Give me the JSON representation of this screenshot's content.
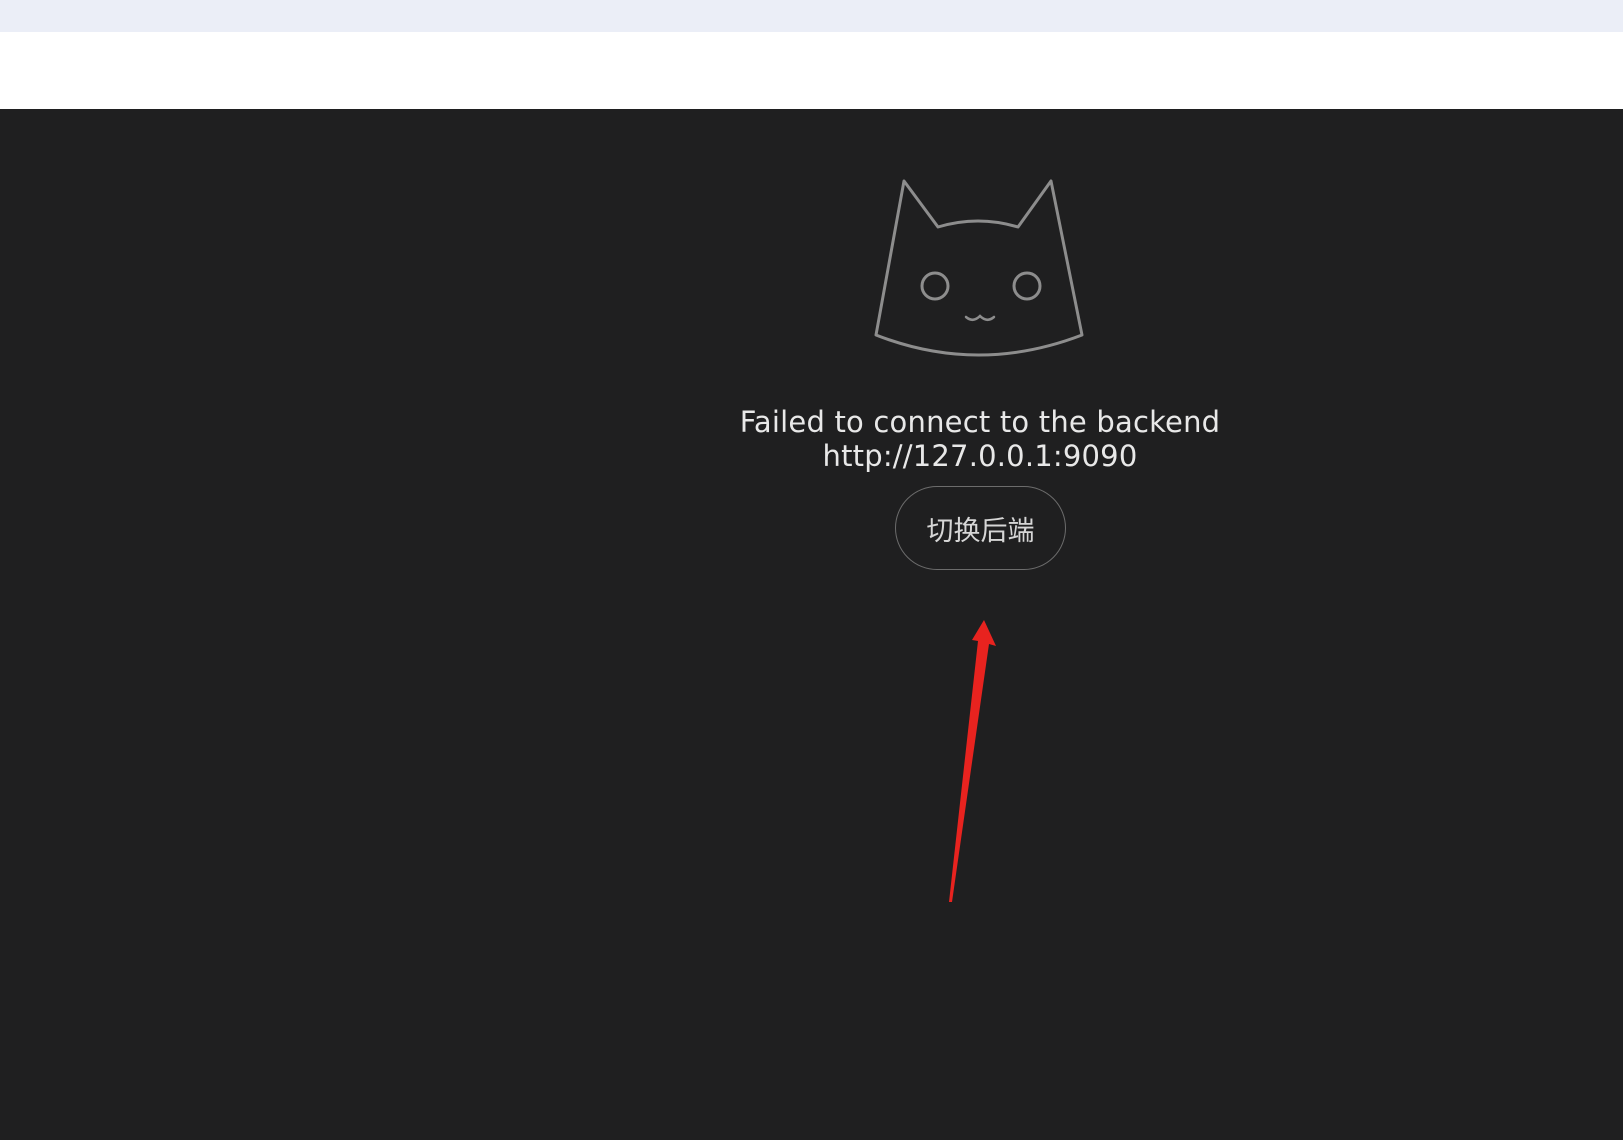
{
  "error": {
    "message": "Failed to connect to the backend http://127.0.0.1:9090"
  },
  "actions": {
    "switch_backend_label": "切换后端"
  },
  "logo": {
    "icon": "cat-face-icon"
  },
  "annotation": {
    "arrow_color": "#e8231f",
    "icon": "red-arrow-icon"
  },
  "colors": {
    "background": "#1f1f20",
    "top_strip": "#ebeef7",
    "text": "#e8e8e8",
    "button_border": "#6c6c6c"
  }
}
